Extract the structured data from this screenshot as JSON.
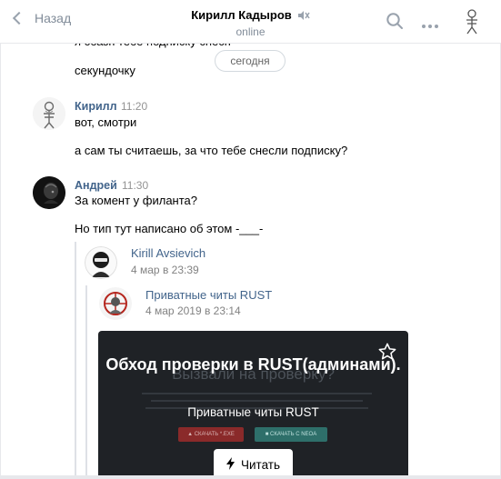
{
  "header": {
    "back_label": "Назад",
    "title": "Кирилл Кадыров",
    "status": "online"
  },
  "feed": {
    "partial_top_text": "я сбазп тебе подписку снесп",
    "date_pill": "сегодня",
    "msg_intro_second": "секундочку",
    "group_kirill": {
      "name": "Кирилл",
      "time": "11:20",
      "lines": [
        "вот, смотри",
        "а сам ты считаешь, за что тебе снесли подписку?"
      ]
    },
    "group_andrey": {
      "name": "Андрей",
      "time": "11:30",
      "lines": [
        "За комент у филанта?",
        "Но тип тут написано об этом -___-"
      ],
      "forward": {
        "name": "Kirill Avsievich",
        "date": "4 мар в 23:39",
        "nested": {
          "name": "Приватные читы RUST",
          "date": "4 мар 2019 в 23:14"
        }
      }
    }
  },
  "card": {
    "ghost_heading": "Вызвали на проверку?",
    "title": "Обход проверки в RUST(админами).",
    "subtitle": "Приватные читы RUST",
    "btn_left": "▲ СКАЧАТЬ *.EXE",
    "btn_right": "■ СКАЧАТЬ С NEOA",
    "read_label": "Читать"
  },
  "colors": {
    "link": "#42648b",
    "card_bg": "#1f2226",
    "muted": "#818c99"
  },
  "icons": {
    "back": "chevron-left-icon",
    "mute": "muted-speaker-icon",
    "search": "search-icon",
    "more": "more-dots-icon",
    "star": "star-icon",
    "lightning": "lightning-icon"
  }
}
